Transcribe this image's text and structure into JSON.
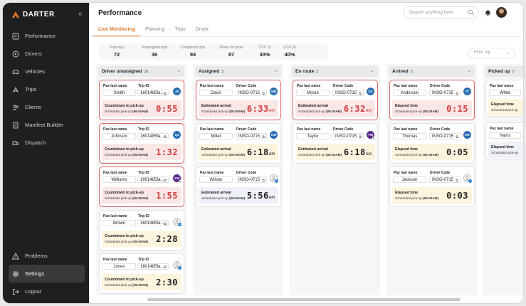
{
  "app": {
    "name": "DARTER"
  },
  "nav": {
    "items": [
      {
        "label": "Performance",
        "icon": "performance-icon"
      },
      {
        "label": "Drivers",
        "icon": "drivers-icon"
      },
      {
        "label": "Vehicles",
        "icon": "vehicles-icon"
      },
      {
        "label": "Trips",
        "icon": "trips-icon"
      },
      {
        "label": "Clients",
        "icon": "clients-icon"
      },
      {
        "label": "Manifest Builder",
        "icon": "manifest-icon"
      },
      {
        "label": "Dispatch",
        "icon": "dispatch-icon"
      }
    ],
    "bottom": [
      {
        "label": "Problems",
        "icon": "warning-icon"
      },
      {
        "label": "Settings",
        "icon": "gear-icon"
      },
      {
        "label": "Logout",
        "icon": "logout-icon"
      }
    ]
  },
  "header": {
    "title": "Performance",
    "search_placeholder": "Search anything here"
  },
  "tabs": [
    "Live Monitoring",
    "Planning",
    "Trips",
    "Driver"
  ],
  "stats": [
    {
      "label": "Total trips",
      "value": "72"
    },
    {
      "label": "Unassigned trips",
      "value": "36"
    },
    {
      "label": "Completed trips",
      "value": "94"
    },
    {
      "label": "Driver no show",
      "value": "87"
    },
    {
      "label": "OTP 15",
      "value": "30%"
    },
    {
      "label": "OTP 30",
      "value": "40%"
    }
  ],
  "filter": {
    "placeholder": "Filter trip"
  },
  "columns": [
    {
      "title": "Driver unassigned",
      "count": "10"
    },
    {
      "title": "Assigned",
      "count": "3"
    },
    {
      "title": "En route",
      "count": "2"
    },
    {
      "title": "Arrived",
      "count": "3"
    },
    {
      "title": "Picked up",
      "count": "2"
    }
  ],
  "labels": {
    "pax": "Pax last name",
    "trip": "Trip ID",
    "driver": "Driver Code",
    "countdown": "Countdown to pick-up",
    "estimated": "Estimated arrival",
    "elapsed": "Elapsed time",
    "scheduled": "Scheduled pick-up",
    "am": "AM"
  },
  "cards": {
    "unassigned": [
      {
        "pax": "Smith",
        "trip": "1601485fa...",
        "initials": "JS",
        "time": "0:55",
        "sched": "(06:00AM)"
      },
      {
        "pax": "Johnson",
        "trip": "1601485fa...",
        "initials": "QJ",
        "time": "1:32",
        "sched": "(06:00AM)"
      },
      {
        "pax": "Williams",
        "trip": "1601485fa...",
        "initials": "YW",
        "time": "1:55",
        "sched": "(06:00AM)"
      },
      {
        "pax": "Brown",
        "trip": "1601485fa...",
        "time": "2:28",
        "sched": "(06:00AM)"
      },
      {
        "pax": "Jones",
        "trip": "1601485fa...",
        "time": "2:30",
        "sched": "(06:00AM)"
      }
    ],
    "assigned": [
      {
        "pax": "Davis",
        "code": "INSO-0715",
        "initials": "WB",
        "time": "6:33",
        "sched": "(06:00AM)"
      },
      {
        "pax": "Miller",
        "code": "INSO-0715",
        "initials": "CW",
        "time": "6:18",
        "sched": "(06:00AM)"
      },
      {
        "pax": "Wilson",
        "code": "INSO-0715",
        "time": "5:56",
        "sched": "(06:00AM)"
      }
    ],
    "enroute": [
      {
        "pax": "Moore",
        "code": "INSO-0715",
        "initials": "CK",
        "time": "6:32",
        "sched": "(06:00AM)"
      },
      {
        "pax": "Taylor",
        "code": "INSO-0715",
        "initials": "YW",
        "time": "6:18",
        "sched": "(06:00AM)"
      }
    ],
    "arrived": [
      {
        "pax": "Anderson",
        "code": "INSO-0715",
        "initials": "TT",
        "time": "0:15",
        "sched": "(06:00AM)"
      },
      {
        "pax": "Thomas",
        "code": "INSO-0715",
        "initials": "HN",
        "time": "0:05",
        "sched": "(06:00AM)"
      },
      {
        "pax": "Jackson",
        "code": "INSO-0715",
        "time": "0:03",
        "sched": "(06:00AM)"
      }
    ],
    "pickedup": [
      {
        "pax": "White"
      },
      {
        "pax": "Harris"
      }
    ]
  },
  "colors": {
    "accent": "#e07a2a",
    "danger": "#d23c3c",
    "sidebar": "#1f1f1f",
    "badge_blue": "#2a6fb3",
    "badge_purple": "#5b2a8a"
  }
}
